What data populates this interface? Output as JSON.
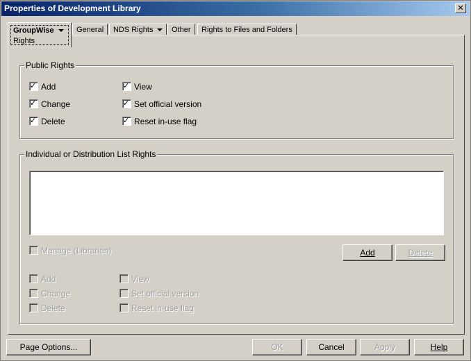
{
  "window": {
    "title": "Properties of Development Library",
    "close_label": "✕"
  },
  "tabs": {
    "groupwise": {
      "label": "GroupWise",
      "sub_label": "Rights"
    },
    "general": "General",
    "nds_rights": "NDS Rights",
    "other": "Other",
    "rights_files": "Rights to Files and Folders"
  },
  "public_rights": {
    "title": "Public Rights",
    "items": [
      {
        "label": "Add",
        "checked": true
      },
      {
        "label": "Change",
        "checked": true
      },
      {
        "label": "Delete",
        "checked": true
      },
      {
        "label": "View",
        "checked": true
      },
      {
        "label": "Set official version",
        "checked": true
      },
      {
        "label": "Reset in-use flag",
        "checked": true
      }
    ]
  },
  "individual_rights": {
    "title": "Individual or Distribution List Rights",
    "manage_label": "Manage (Librarian)",
    "add_button": "Add",
    "delete_button": "Delete",
    "items": [
      {
        "label": "Add",
        "checked": false
      },
      {
        "label": "Change",
        "checked": false
      },
      {
        "label": "Delete",
        "checked": false
      },
      {
        "label": "View",
        "checked": false
      },
      {
        "label": "Set official version",
        "checked": false
      },
      {
        "label": "Reset in-use flag",
        "checked": false
      }
    ]
  },
  "footer": {
    "page_options": "Page Options...",
    "ok": "OK",
    "cancel": "Cancel",
    "apply": "Apply",
    "help": "Help"
  }
}
